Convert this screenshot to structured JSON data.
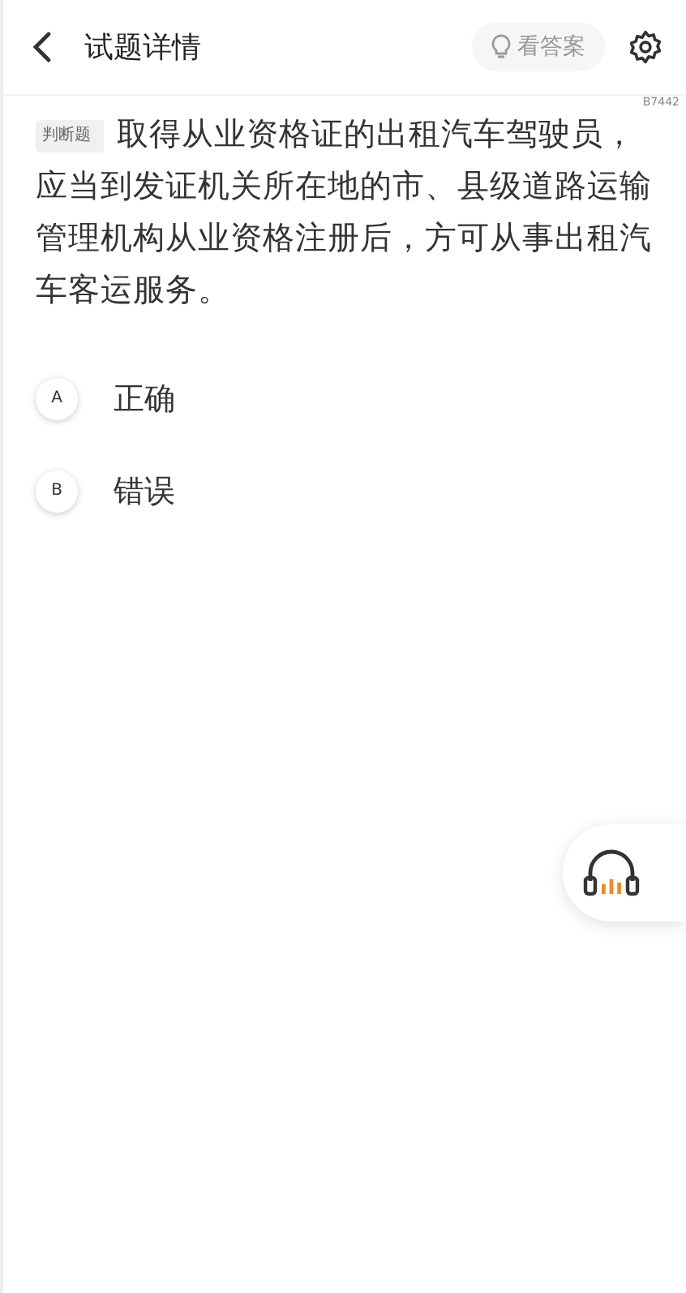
{
  "header": {
    "title": "试题详情",
    "answer_button": "看答案"
  },
  "code": "B7442",
  "question": {
    "type_tag": "判断题",
    "text": "取得从业资格证的出租汽车驾驶员，应当到发证机关所在地的市、县级道路运输管理机构从业资格注册后，方可从事出租汽车客运服务。"
  },
  "options": [
    {
      "letter": "A",
      "text": "正确",
      "selected": false
    },
    {
      "letter": "B",
      "text": "错误",
      "selected": false
    }
  ]
}
